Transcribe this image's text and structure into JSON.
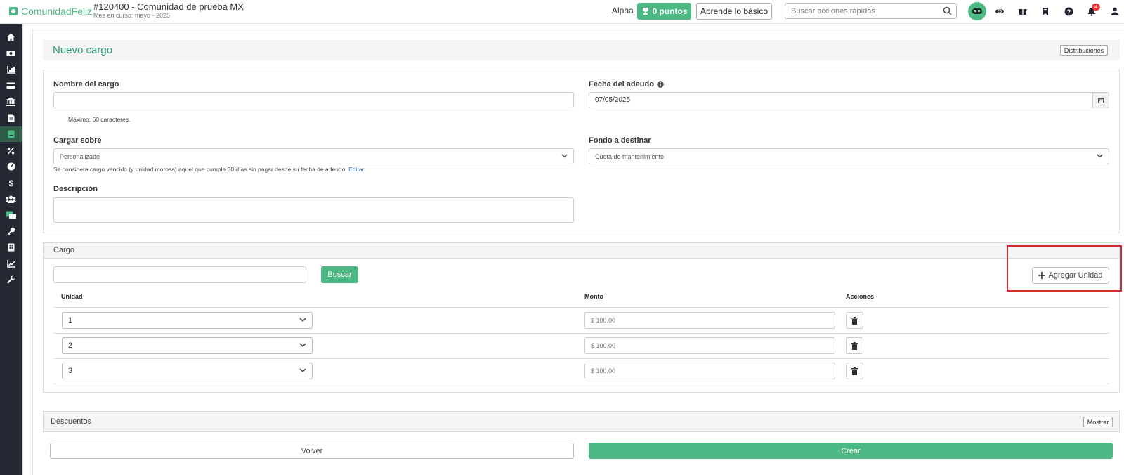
{
  "header": {
    "brand": "ComunidadFeliz",
    "community_title": "#120400 - Comunidad de prueba MX",
    "community_subtitle": "Mes en curso: mayo - 2025",
    "alpha_label": "Alpha",
    "points_label": "0 puntos",
    "learn_label": "Aprende lo básico",
    "search_placeholder": "Buscar acciones rápidas",
    "notification_count": "4",
    "icons": [
      "search-icon",
      "avatar-icon",
      "compass-icon",
      "gift-icon",
      "bookmark-icon",
      "help-icon",
      "bell-icon",
      "user-icon"
    ]
  },
  "sidebar": {
    "icons": [
      "home-icon",
      "money-icon",
      "chart-icon",
      "card-icon",
      "bank-icon",
      "document-icon",
      "book-icon",
      "percent-icon",
      "gauge-icon",
      "dollar-icon",
      "users-icon",
      "chat-icon",
      "key-icon",
      "building-icon",
      "line-chart-icon",
      "wrench-icon"
    ],
    "active_index": 6
  },
  "page": {
    "title": "Nuevo cargo",
    "distribuciones_label": "Distribuciones"
  },
  "form": {
    "nombre_label": "Nombre del cargo",
    "nombre_value": "",
    "nombre_help": "Máximo: 60 caracteres.",
    "fecha_label": "Fecha del adeudo",
    "fecha_value": "07/05/2025",
    "cargar_label": "Cargar sobre",
    "cargar_value": "Personalizado",
    "cargar_help": "Se considera cargo vencido (y unidad morosa) aquel que cumple 30 días sin pagar desde su fecha de adeudo.",
    "cargar_help_link": "Editar",
    "fondo_label": "Fondo a destinar",
    "fondo_value": "Cuota de mantenimiento",
    "descripcion_label": "Descripción",
    "descripcion_value": ""
  },
  "cargo": {
    "section_title": "Cargo",
    "search_value": "",
    "buscar_label": "Buscar",
    "agregar_label": "Agregar Unidad",
    "columns": {
      "unidad": "Unidad",
      "monto": "Monto",
      "acciones": "Acciones"
    },
    "rows": [
      {
        "unidad": "1",
        "monto": "$ 100.00"
      },
      {
        "unidad": "2",
        "monto": "$ 100.00"
      },
      {
        "unidad": "3",
        "monto": "$ 100.00"
      }
    ]
  },
  "descuentos": {
    "section_title": "Descuentos",
    "mostrar_label": "Mostrar"
  },
  "actions": {
    "volver_label": "Volver",
    "crear_label": "Crear"
  },
  "colors": {
    "brand_green": "#4cb884",
    "sidebar_bg": "#232832",
    "highlight_red": "#d32f2f",
    "link_blue": "#2f6fb8"
  }
}
